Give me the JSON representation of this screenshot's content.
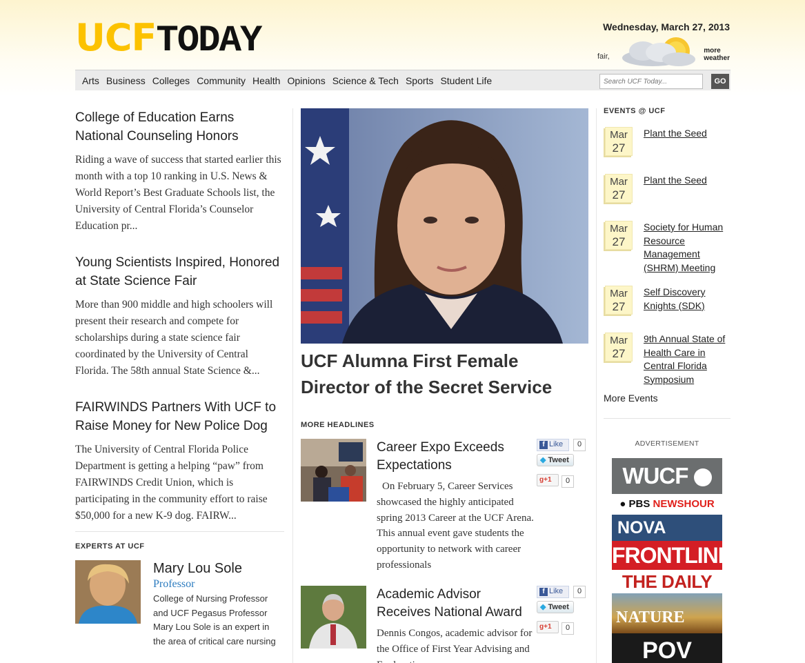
{
  "header": {
    "logo_ucf": "UCF",
    "logo_today": "TODAY",
    "date": "Wednesday, March 27, 2013",
    "weather_condition": "fair,",
    "weather_more_1": "more",
    "weather_more_2": "weather"
  },
  "nav": {
    "items": [
      {
        "label": "Arts"
      },
      {
        "label": "Business"
      },
      {
        "label": "Colleges"
      },
      {
        "label": "Community"
      },
      {
        "label": "Health"
      },
      {
        "label": "Opinions"
      },
      {
        "label": "Science & Tech"
      },
      {
        "label": "Sports"
      },
      {
        "label": "Student Life"
      }
    ],
    "search_placeholder": "Search UCF Today...",
    "search_button": "GO"
  },
  "left_stories": [
    {
      "title": "College of Education Earns National Counseling Honors",
      "summary": "Riding a wave of success that started earlier this month with a top 10 ranking in U.S. News & World Report’s Best Graduate Schools list, the University of Central Florida’s Counselor Education pr..."
    },
    {
      "title": "Young Scientists Inspired, Honored at State Science Fair",
      "summary": "More than 900 middle and high schoolers will present their research and compete for scholarships during a state science fair coordinated by the University of Central Florida. The 58th annual State Science &..."
    },
    {
      "title": "FAIRWINDS Partners With UCF to Raise Money for New Police Dog",
      "summary": "The University of Central Florida Police Department is getting a helping “paw” from FAIRWINDS Credit Union, which is participating in the community effort to raise $50,000 for a new K-9 dog. FAIRW..."
    }
  ],
  "experts": {
    "heading": "EXPERTS AT UCF",
    "name": "Mary Lou Sole",
    "title": "Professor",
    "description": "College of Nursing Professor and UCF Pegasus Professor Mary Lou Sole is an expert in the area of critical care nursing"
  },
  "feature": {
    "title": "UCF Alumna First Female Director of the Secret Service"
  },
  "more_headlines": {
    "heading": "MORE HEADLINES",
    "items": [
      {
        "title": "Career Expo Exceeds Expectations",
        "body": "On February 5, Career Services showcased the highly anticipated spring 2013 Career at the UCF Arena. This annual event gave students the opportunity to network with career professionals",
        "like_label": "Like",
        "like_count": "0",
        "tweet_label": "Tweet",
        "plus_label": "+1",
        "plus_count": "0"
      },
      {
        "title": "Academic Advisor Receives National Award",
        "body": "Dennis Congos, academic advisor for the Office of First Year Advising and Exploration",
        "like_label": "Like",
        "like_count": "0",
        "tweet_label": "Tweet",
        "plus_label": "+1",
        "plus_count": "0"
      }
    ]
  },
  "events": {
    "heading": "EVENTS @ UCF",
    "items": [
      {
        "month": "Mar",
        "day": "27",
        "title": "Plant the Seed"
      },
      {
        "month": "Mar",
        "day": "27",
        "title": "Plant the Seed"
      },
      {
        "month": "Mar",
        "day": "27",
        "title": "Society for Human Resource Management (SHRM) Meeting"
      },
      {
        "month": "Mar",
        "day": "27",
        "title": "Self Discovery Knights (SDK)"
      },
      {
        "month": "Mar",
        "day": "27",
        "title": "9th Annual State of Health Care in Central Florida Symposium"
      }
    ],
    "more": "More Events"
  },
  "advertisement": {
    "label": "ADVERTISEMENT",
    "wucf": "WUCF",
    "pbs_1": "PBS",
    "pbs_2": "NEWSHOUR",
    "nova": "NOVA",
    "frontline": "FRONTLINE",
    "daily_need": "THE DAILY NEED",
    "nature": "NATURE",
    "pov": "POV"
  }
}
